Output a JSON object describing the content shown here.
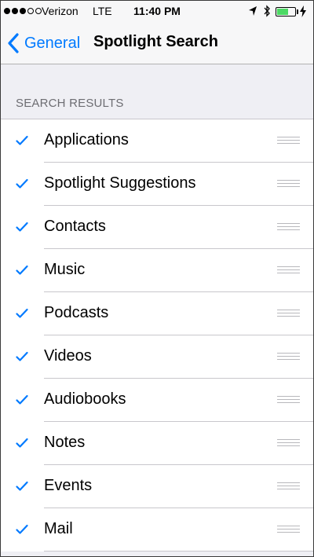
{
  "status_bar": {
    "carrier": "Verizon",
    "network": "LTE",
    "time": "11:40 PM",
    "signal_bars_filled": 3,
    "signal_bars_total": 5,
    "battery_level": 0.65,
    "battery_color": "#4cd964"
  },
  "nav": {
    "back_label": "General",
    "title": "Spotlight Search",
    "accent_color": "#007aff"
  },
  "section": {
    "header": "SEARCH RESULTS"
  },
  "items": [
    {
      "label": "Applications",
      "checked": true
    },
    {
      "label": "Spotlight Suggestions",
      "checked": true
    },
    {
      "label": "Contacts",
      "checked": true
    },
    {
      "label": "Music",
      "checked": true
    },
    {
      "label": "Podcasts",
      "checked": true
    },
    {
      "label": "Videos",
      "checked": true
    },
    {
      "label": "Audiobooks",
      "checked": true
    },
    {
      "label": "Notes",
      "checked": true
    },
    {
      "label": "Events",
      "checked": true
    },
    {
      "label": "Mail",
      "checked": true
    }
  ],
  "icons": {
    "location": "location-arrow-icon",
    "bluetooth": "bluetooth-icon",
    "battery": "battery-icon",
    "charging": "charging-bolt-icon",
    "back": "chevron-left-icon",
    "check": "checkmark-icon",
    "reorder": "reorder-grabber-icon"
  }
}
